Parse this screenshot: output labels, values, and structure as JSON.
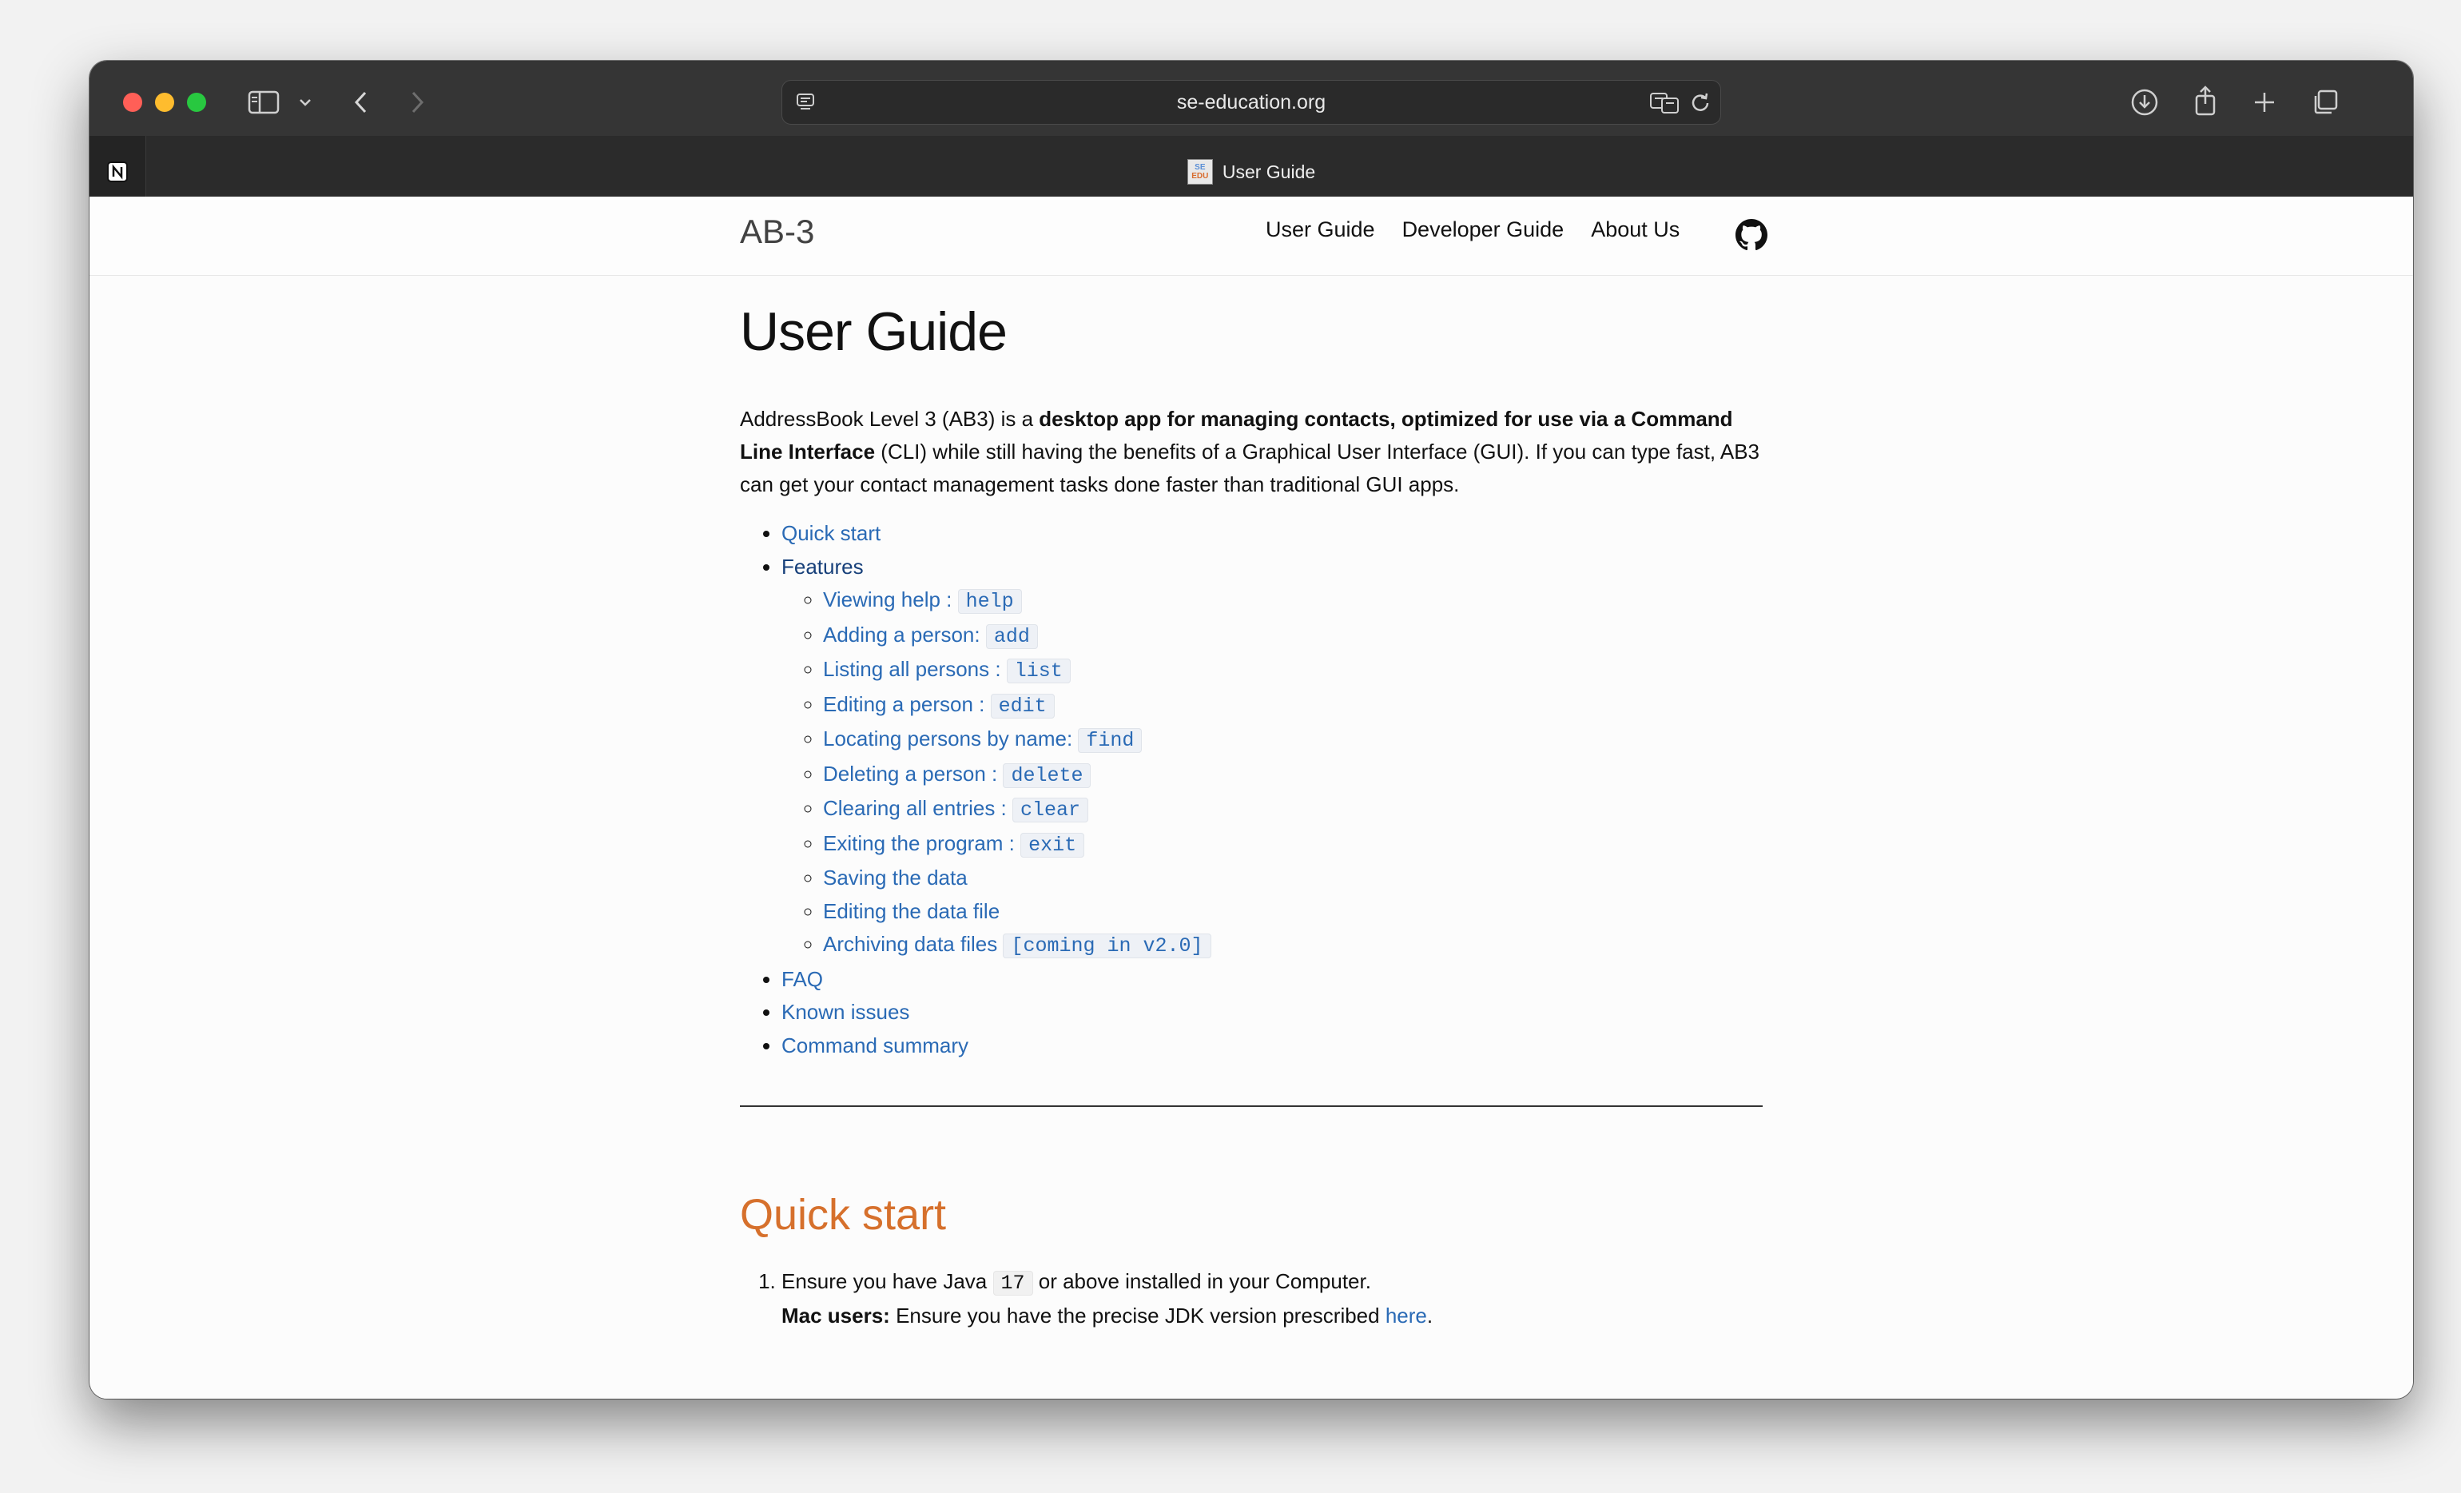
{
  "browser": {
    "url": "se-education.org",
    "tab_title": "User Guide"
  },
  "site": {
    "brand": "AB-3",
    "nav": [
      "User Guide",
      "Developer Guide",
      "About Us"
    ]
  },
  "page": {
    "title": "User Guide",
    "intro": {
      "t1": "AddressBook Level 3 (AB3) is a ",
      "b1": "desktop app for managing contacts, optimized for use via a Command Line Interface",
      "t2": " (CLI) while still having the benefits of a Graphical User Interface (GUI). If you can type fast, AB3 can get your contact management tasks done faster than traditional GUI apps."
    },
    "toc": {
      "quick_start": "Quick start",
      "features": "Features",
      "features_items": [
        {
          "label": "Viewing help : ",
          "code": "help"
        },
        {
          "label": "Adding a person: ",
          "code": "add"
        },
        {
          "label": "Listing all persons : ",
          "code": "list"
        },
        {
          "label": "Editing a person : ",
          "code": "edit"
        },
        {
          "label": "Locating persons by name: ",
          "code": "find"
        },
        {
          "label": "Deleting a person : ",
          "code": "delete"
        },
        {
          "label": "Clearing all entries : ",
          "code": "clear"
        },
        {
          "label": "Exiting the program : ",
          "code": "exit"
        },
        {
          "label": "Saving the data",
          "code": ""
        },
        {
          "label": "Editing the data file",
          "code": ""
        },
        {
          "label": "Archiving data files ",
          "code": "[coming in v2.0]"
        }
      ],
      "faq": "FAQ",
      "known_issues": "Known issues",
      "command_summary": "Command summary"
    },
    "quick_start": {
      "heading": "Quick start",
      "step1_pre": "Ensure you have Java ",
      "step1_code": "17",
      "step1_post": " or above installed in your Computer.",
      "mac_bold": "Mac users:",
      "mac_text": " Ensure you have the precise JDK version prescribed ",
      "mac_link": "here",
      "mac_end": "."
    }
  },
  "colors": {
    "link": "#2a6ab5",
    "heading_orange": "#d6702c",
    "toolbar": "#353535"
  }
}
